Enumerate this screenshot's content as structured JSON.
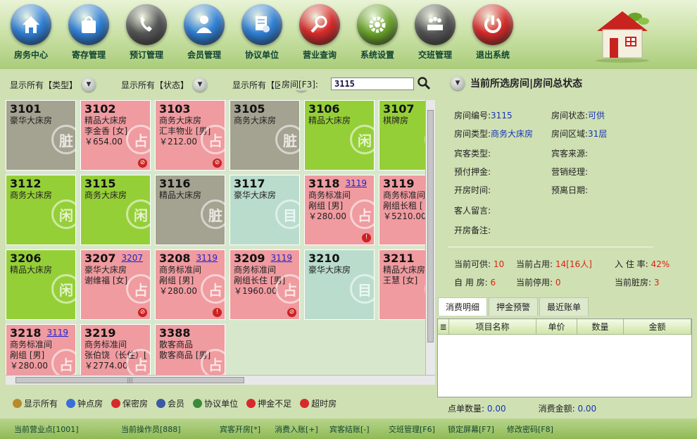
{
  "toolbar": [
    {
      "label": "房务中心",
      "icon": "home-icon",
      "color": "#2f7fd6"
    },
    {
      "label": "寄存管理",
      "icon": "bag-icon",
      "color": "#2f7fd6"
    },
    {
      "label": "预订管理",
      "icon": "phone-icon",
      "color": "#555555"
    },
    {
      "label": "会员管理",
      "icon": "user-icon",
      "color": "#2f7fd6"
    },
    {
      "label": "协议单位",
      "icon": "certificate-icon",
      "color": "#2f7fd6"
    },
    {
      "label": "营业查询",
      "icon": "magnifier-icon",
      "color": "#d62a2a"
    },
    {
      "label": "系统设置",
      "icon": "gear-icon",
      "color": "#6aa32a"
    },
    {
      "label": "交班管理",
      "icon": "meeting-icon",
      "color": "#555555"
    },
    {
      "label": "退出系统",
      "icon": "power-icon",
      "color": "#d62a2a"
    }
  ],
  "filters": {
    "type": "显示所有【类型】",
    "status": "显示所有【状态】",
    "area": "显示所有【区域】",
    "room_label": "房间[F3]:",
    "room_value": "3115"
  },
  "rooms": [
    {
      "num": "3101",
      "type": "豪华大床房",
      "lines": [],
      "status": "dirty",
      "stamp": "脏",
      "ref": "",
      "flag": ""
    },
    {
      "num": "3102",
      "type": "精品大床房",
      "lines": [
        "李金香 [女]",
        "￥654.00"
      ],
      "status": "occ",
      "stamp": "占",
      "ref": "",
      "flag": "⊘"
    },
    {
      "num": "3103",
      "type": "商务大床房",
      "lines": [
        "汇丰物业 [男]",
        "￥212.00"
      ],
      "status": "occ",
      "stamp": "占",
      "ref": "",
      "flag": "⊘"
    },
    {
      "num": "3105",
      "type": "商务大床房",
      "lines": [],
      "status": "dirty",
      "stamp": "脏",
      "ref": "",
      "flag": ""
    },
    {
      "num": "3106",
      "type": "精品大床房",
      "lines": [],
      "status": "free",
      "stamp": "闲",
      "ref": "",
      "flag": ""
    },
    {
      "num": "3107",
      "type": "棋牌房",
      "lines": [],
      "status": "free",
      "stamp": "闲",
      "ref": "",
      "flag": ""
    },
    {
      "num": "3112",
      "type": "商务大床房",
      "lines": [],
      "status": "free",
      "stamp": "闲",
      "ref": "",
      "flag": ""
    },
    {
      "num": "3115",
      "type": "商务大床房",
      "lines": [],
      "status": "free",
      "stamp": "闲",
      "ref": "",
      "flag": ""
    },
    {
      "num": "3116",
      "type": "精品大床房",
      "lines": [],
      "status": "dirty",
      "stamp": "脏",
      "ref": "",
      "flag": ""
    },
    {
      "num": "3117",
      "type": "豪华大床房",
      "lines": [],
      "status": "reserved",
      "stamp": "目",
      "ref": "",
      "flag": ""
    },
    {
      "num": "3118",
      "type": "商务标准间",
      "lines": [
        "剐组 [男]",
        "￥280.00"
      ],
      "status": "occ",
      "stamp": "占",
      "ref": "3119",
      "flag": "!"
    },
    {
      "num": "3119",
      "type": "商务标准间",
      "lines": [
        "剐组长租 [",
        "￥5210.00"
      ],
      "status": "occ",
      "stamp": "占",
      "ref": "",
      "flag": ""
    },
    {
      "num": "3206",
      "type": "精品大床房",
      "lines": [],
      "status": "free",
      "stamp": "闲",
      "ref": "",
      "flag": ""
    },
    {
      "num": "3207",
      "type": "豪华大床房",
      "lines": [
        "谢维福 [女]"
      ],
      "status": "occ",
      "stamp": "占",
      "ref": "3207",
      "flag": "⊘"
    },
    {
      "num": "3208",
      "type": "商务标准间",
      "lines": [
        "剐组 [男]",
        "￥280.00"
      ],
      "status": "occ",
      "stamp": "占",
      "ref": "3119",
      "flag": "!"
    },
    {
      "num": "3209",
      "type": "商务标准间",
      "lines": [
        "剐组长住 [男]",
        "￥1960.00"
      ],
      "status": "occ",
      "stamp": "占",
      "ref": "3119",
      "flag": "⊘"
    },
    {
      "num": "3210",
      "type": "豪华大床房",
      "lines": [],
      "status": "reserved",
      "stamp": "目",
      "ref": "",
      "flag": ""
    },
    {
      "num": "3211",
      "type": "精品大床房",
      "lines": [
        "王慧 [女]"
      ],
      "status": "occ",
      "stamp": "占",
      "ref": "",
      "flag": ""
    },
    {
      "num": "3218",
      "type": "商务标准间",
      "lines": [
        "剐组 [男]",
        "￥280.00"
      ],
      "status": "occ",
      "stamp": "占",
      "ref": "3119",
      "flag": ""
    },
    {
      "num": "3219",
      "type": "商务标准间",
      "lines": [
        "张伯饶（长住）[",
        "￥2774.00"
      ],
      "status": "occ",
      "stamp": "占",
      "ref": "",
      "flag": ""
    },
    {
      "num": "3388",
      "type": "散客商品",
      "lines": [
        "散客商品 [男]"
      ],
      "status": "occ",
      "stamp": "占",
      "ref": "",
      "flag": ""
    }
  ],
  "legend": [
    {
      "label": "显示所有",
      "icon": "gear-small-icon",
      "color": "#b88a2a"
    },
    {
      "label": "钟点房",
      "icon": "clock-icon",
      "color": "#3a6fd6"
    },
    {
      "label": "保密房",
      "icon": "minus-circle-icon",
      "color": "#d62a2a"
    },
    {
      "label": "会员",
      "icon": "member-icon",
      "color": "#3a5aa6"
    },
    {
      "label": "协议单位",
      "icon": "group-icon",
      "color": "#3a8a3a"
    },
    {
      "label": "押金不足",
      "icon": "warning-icon",
      "color": "#d62a2a"
    },
    {
      "label": "超时房",
      "icon": "forbidden-icon",
      "color": "#d62a2a"
    }
  ],
  "panel": {
    "title": "当前所选房间|房间总状态",
    "room_no_label": "房间编号:",
    "room_no": "3115",
    "room_status_label": "房间状态:",
    "room_status": "可供",
    "room_type_label": "房间类型:",
    "room_type": "商务大床房",
    "room_area_label": "房间区域:",
    "room_area": "31层",
    "guest_type_label": "宾客类型:",
    "guest_source_label": "宾客来源:",
    "deposit_label": "预付押金:",
    "sales_mgr_label": "营销经理:",
    "open_time_label": "开房时间:",
    "leave_date_label": "预离日期:",
    "guest_msg_label": "客人留言:",
    "open_note_label": "开房备注:"
  },
  "stats": {
    "avail_label": "当前可供:",
    "avail": "10",
    "occ_label": "当前占用:",
    "occ": "14[16人]",
    "rate_label": "入 住 率:",
    "rate": "42%",
    "self_label": "自 用 房:",
    "self": "6",
    "stop_label": "当前停用:",
    "stop": "0",
    "dirty_label": "当前脏房:",
    "dirty": "3"
  },
  "tabs": [
    "消费明细",
    "押金预警",
    "最近账单"
  ],
  "table_headers": [
    "项目名称",
    "单价",
    "数量",
    "金额"
  ],
  "footer": {
    "count_label": "点单数量:",
    "count": "0.00",
    "amount_label": "消费金额:",
    "amount": "0.00"
  },
  "status_bar": [
    "当前营业点[1001]",
    "当前操作员[888]",
    "宾客开房[*]",
    "消费入账[+]",
    "宾客结账[-]",
    "交班管理[F6]",
    "锁定屏幕[F7]",
    "修改密码[F8]"
  ]
}
